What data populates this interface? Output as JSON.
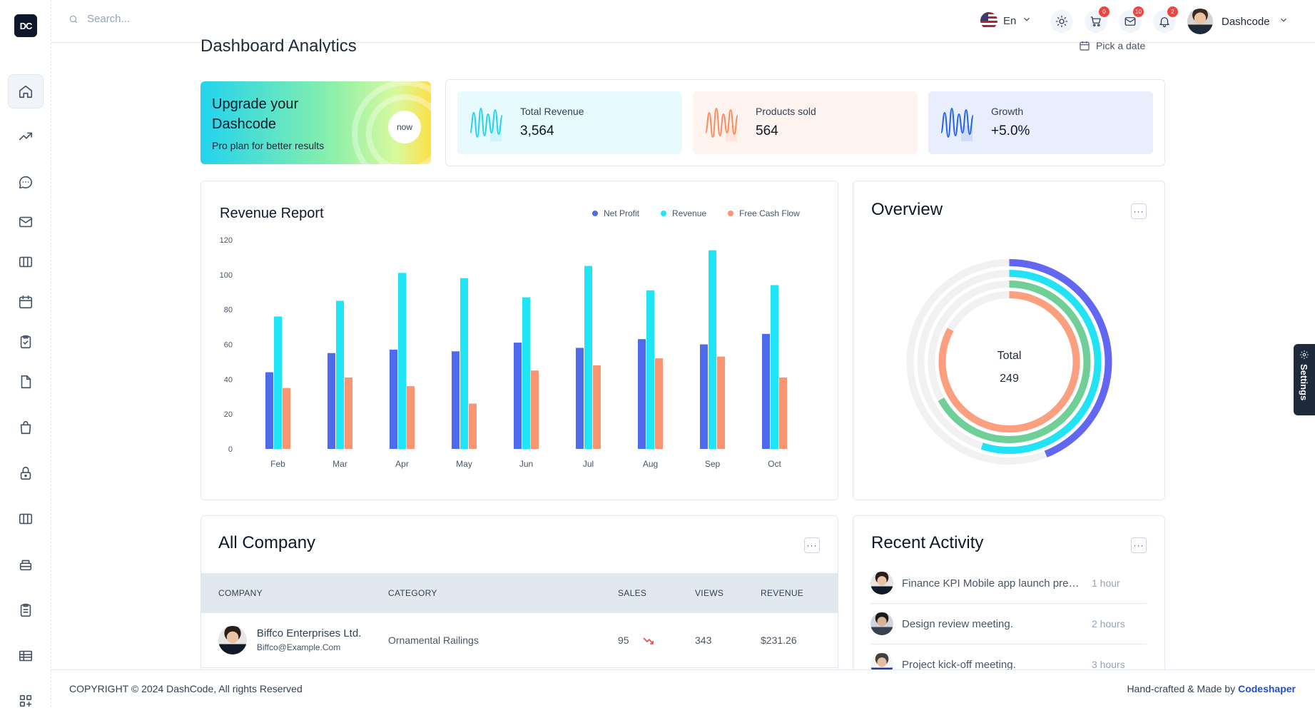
{
  "brand": {
    "logo_text": "DC",
    "user_name": "Dashcode"
  },
  "search": {
    "placeholder": "Search..."
  },
  "header": {
    "language": "En",
    "cart_badge": "0",
    "mail_badge": "10",
    "notif_badge": "2"
  },
  "page": {
    "title": "Dashboard Analytics",
    "date_picker": "Pick a date"
  },
  "upgrade": {
    "title": "Upgrade your Dashcode",
    "subtitle": "Pro plan for better results",
    "button": "now"
  },
  "stats": [
    {
      "label": "Total Revenue",
      "value": "3,564",
      "color": "#22d3ee",
      "bg": "#e7fafd"
    },
    {
      "label": "Products sold",
      "value": "564",
      "color": "#fb8b5e",
      "bg": "#fef3ee"
    },
    {
      "label": "Growth",
      "value": "+5.0%",
      "color": "#2563eb",
      "bg": "#e8eefb"
    }
  ],
  "revenue_report": {
    "title": "Revenue Report",
    "legend": [
      "Net Profit",
      "Revenue",
      "Free Cash Flow"
    ]
  },
  "chart_data": [
    {
      "type": "bar",
      "title": "Revenue Report",
      "categories": [
        "Feb",
        "Mar",
        "Apr",
        "May",
        "Jun",
        "Jul",
        "Aug",
        "Sep",
        "Oct"
      ],
      "series": [
        {
          "name": "Net Profit",
          "color": "#4f6bed",
          "values": [
            44,
            55,
            57,
            56,
            61,
            58,
            63,
            60,
            66
          ]
        },
        {
          "name": "Revenue",
          "color": "#1fe5f7",
          "values": [
            76,
            85,
            101,
            98,
            87,
            105,
            91,
            114,
            94
          ]
        },
        {
          "name": "Free Cash Flow",
          "color": "#fb9470",
          "values": [
            35,
            41,
            36,
            26,
            45,
            48,
            52,
            53,
            41
          ]
        }
      ],
      "yticks": [
        0,
        20,
        40,
        60,
        80,
        100,
        120
      ],
      "ylim": [
        0,
        120
      ],
      "legend_position": "top-right",
      "grid": false
    },
    {
      "type": "radialBar",
      "title": "Overview",
      "center_label": "Total",
      "center_value": "249",
      "series": [
        {
          "color": "#6366f1",
          "percent": 0.44
        },
        {
          "color": "#22e3f5",
          "percent": 0.55
        },
        {
          "color": "#6fcf97",
          "percent": 0.67
        },
        {
          "color": "#fb9f7e",
          "percent": 0.83
        }
      ]
    }
  ],
  "overview": {
    "title": "Overview",
    "total_label": "Total",
    "total_value": "249"
  },
  "company": {
    "title": "All Company",
    "columns": [
      "COMPANY",
      "CATEGORY",
      "SALES",
      "VIEWS",
      "REVENUE"
    ],
    "rows": [
      {
        "name": "Biffco Enterprises Ltd.",
        "email": "Biffco@Example.Com",
        "category": "Ornamental Railings",
        "sales": "95",
        "views": "343",
        "revenue": "$231.26"
      }
    ]
  },
  "activity": {
    "title": "Recent Activity",
    "items": [
      {
        "text": "Finance KPI Mobile app launch preparion meeting.",
        "time": "1 hour"
      },
      {
        "text": "Design review meeting.",
        "time": "2 hours"
      },
      {
        "text": "Project kick-off meeting.",
        "time": "3 hours"
      }
    ]
  },
  "footer": {
    "copyright": "COPYRIGHT © 2024 DashCode, All rights Reserved",
    "made_by_prefix": "Hand-crafted & Made by",
    "made_by_name": "Codeshaper"
  },
  "settings_tab": {
    "label": "Settings"
  },
  "sidebar": {
    "items": [
      "home-icon",
      "trending-icon",
      "chat-icon",
      "mail-icon",
      "kanban-icon",
      "calendar-icon",
      "clipboard-check-icon",
      "file-icon",
      "shopping-bag-icon",
      "lock-icon",
      "columns-icon",
      "inbox-icon",
      "clipboard-list-icon",
      "table-icon",
      "apps-icon"
    ]
  }
}
